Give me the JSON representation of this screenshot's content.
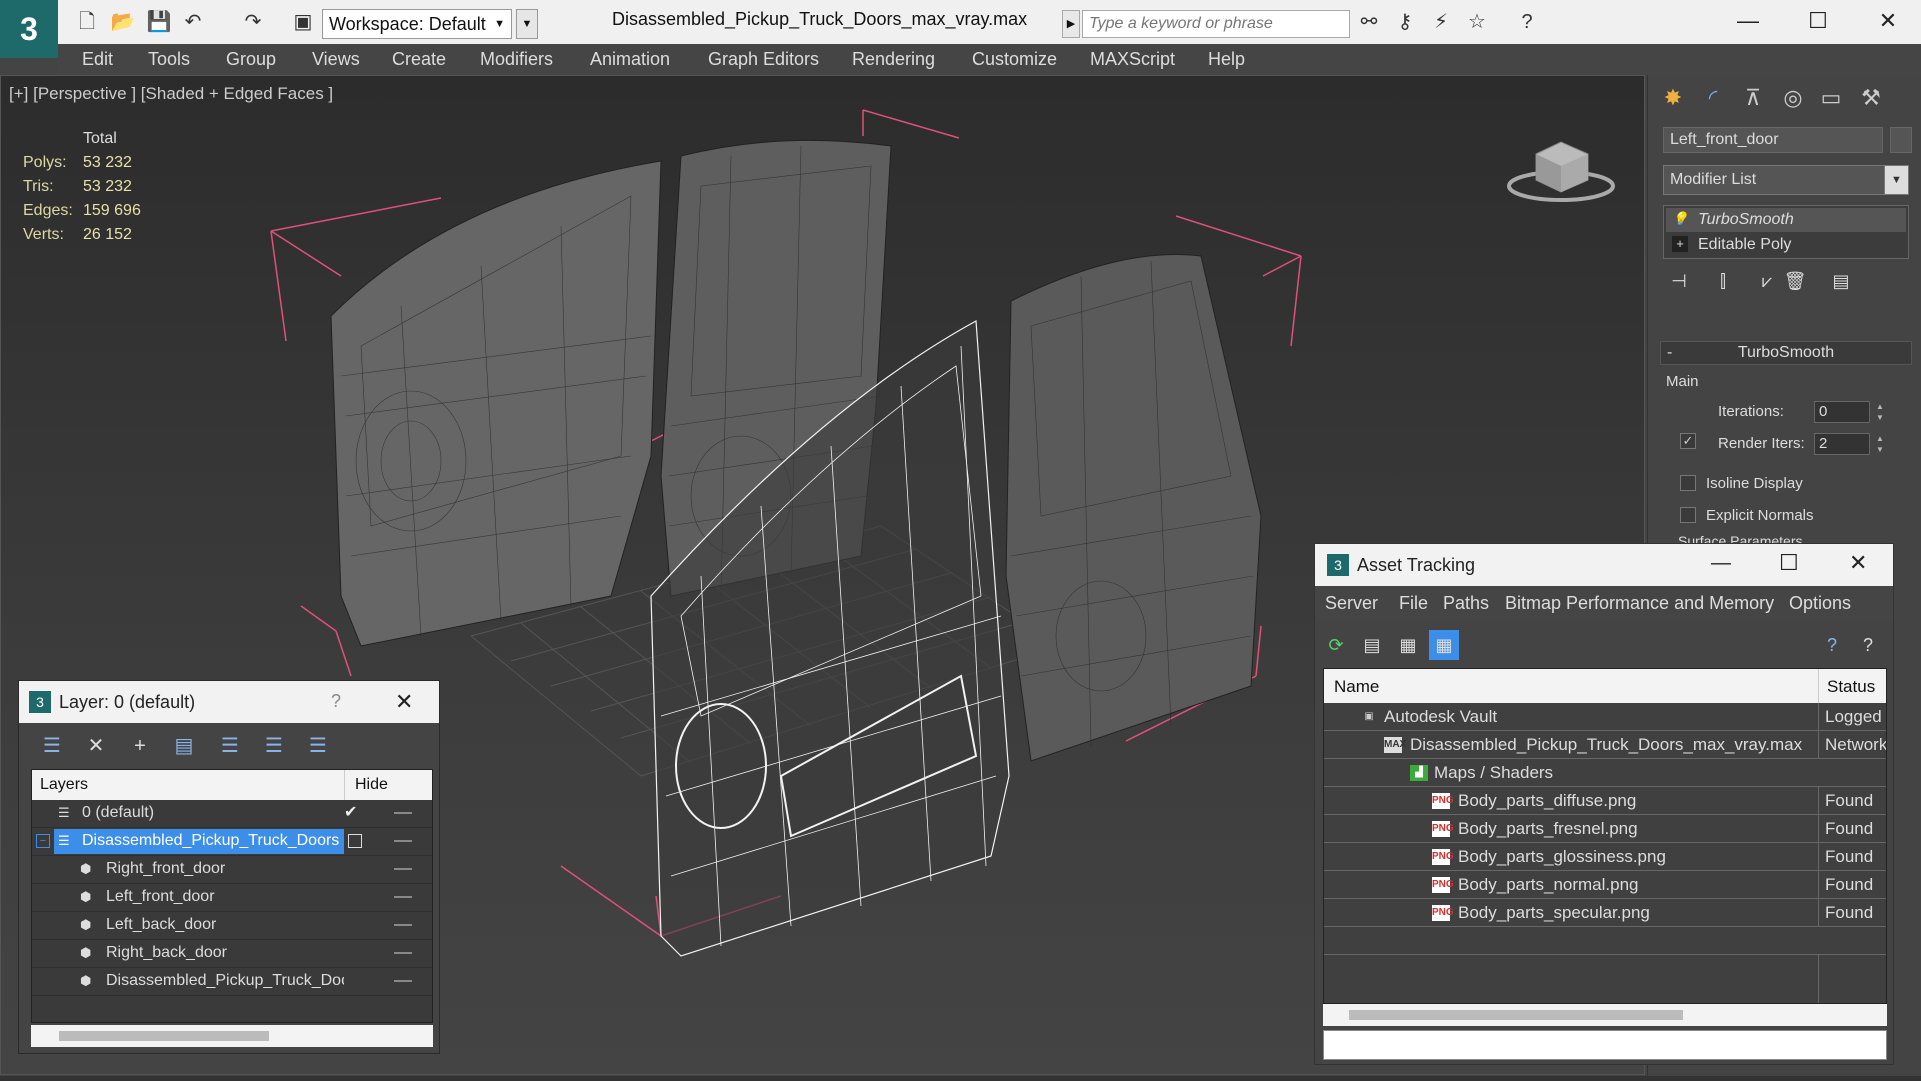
{
  "titlebar": {
    "workspace_label": "Workspace: Default",
    "document_title": "Disassembled_Pickup_Truck_Doors_max_vray.max",
    "search_placeholder": "Type a keyword or phrase",
    "minimize": "—",
    "maximize": "☐",
    "close": "✕"
  },
  "menubar": {
    "items": [
      "Edit",
      "Tools",
      "Group",
      "Views",
      "Create",
      "Modifiers",
      "Animation",
      "Graph Editors",
      "Rendering",
      "Customize",
      "MAXScript",
      "Help"
    ]
  },
  "viewport": {
    "label": "[+] [Perspective ] [Shaded + Edged Faces ]",
    "stats": {
      "header": "Total",
      "rows": [
        {
          "key": "Polys:",
          "value": "53 232"
        },
        {
          "key": "Tris:",
          "value": "53 232"
        },
        {
          "key": "Edges:",
          "value": "159 696"
        },
        {
          "key": "Verts:",
          "value": "26 152"
        }
      ]
    }
  },
  "command_panel": {
    "object_name": "Left_front_door",
    "modifier_list": "Modifier List",
    "stack": [
      {
        "label": "TurboSmooth",
        "icon": "lightbulb-icon"
      },
      {
        "label": "Editable Poly",
        "icon": "plus-box-icon"
      }
    ],
    "rollout_title": "TurboSmooth",
    "main_group": "Main",
    "iterations_label": "Iterations:",
    "iterations_value": "0",
    "render_iters_label": "Render Iters:",
    "render_iters_value": "2",
    "isoline_label": "Isoline Display",
    "explicit_normals_label": "Explicit Normals",
    "surface_params_label": "Surface Parameters"
  },
  "layer_dialog": {
    "title": "Layer: 0 (default)",
    "help": "?",
    "close": "✕",
    "col_layers": "Layers",
    "col_hide": "Hide",
    "rows": [
      {
        "name": "0 (default)",
        "indent": 0,
        "type": "layer",
        "selected": false,
        "current": true
      },
      {
        "name": "Disassembled_Pickup_Truck_Doors",
        "indent": 0,
        "type": "layer",
        "selected": true,
        "current": false
      },
      {
        "name": "Right_front_door",
        "indent": 1,
        "type": "object",
        "selected": false,
        "current": false
      },
      {
        "name": "Left_front_door",
        "indent": 1,
        "type": "object",
        "selected": false,
        "current": false
      },
      {
        "name": "Left_back_door",
        "indent": 1,
        "type": "object",
        "selected": false,
        "current": false
      },
      {
        "name": "Right_back_door",
        "indent": 1,
        "type": "object",
        "selected": false,
        "current": false
      },
      {
        "name": "Disassembled_Pickup_Truck_Doo",
        "indent": 1,
        "type": "object",
        "selected": false,
        "current": false
      }
    ]
  },
  "asset_tracking": {
    "title": "Asset Tracking",
    "minimize": "—",
    "maximize": "☐",
    "close": "✕",
    "menu": [
      "Server",
      "File",
      "Paths",
      "Bitmap Performance and Memory",
      "Options"
    ],
    "col_name": "Name",
    "col_status": "Status",
    "rows": [
      {
        "name": "Autodesk Vault",
        "indent": 1,
        "icon": "vault-icon",
        "status": "Logged O"
      },
      {
        "name": "Disassembled_Pickup_Truck_Doors_max_vray.max",
        "indent": 2,
        "icon": "max-file-icon",
        "status": "Network F"
      },
      {
        "name": "Maps / Shaders",
        "indent": 3,
        "icon": "maps-icon",
        "status": ""
      },
      {
        "name": "Body_parts_diffuse.png",
        "indent": 4,
        "icon": "png-icon",
        "status": "Found"
      },
      {
        "name": "Body_parts_fresnel.png",
        "indent": 4,
        "icon": "png-icon",
        "status": "Found"
      },
      {
        "name": "Body_parts_glossiness.png",
        "indent": 4,
        "icon": "png-icon",
        "status": "Found"
      },
      {
        "name": "Body_parts_normal.png",
        "indent": 4,
        "icon": "png-icon",
        "status": "Found"
      },
      {
        "name": "Body_parts_specular.png",
        "indent": 4,
        "icon": "png-icon",
        "status": "Found"
      }
    ]
  },
  "colors": {
    "accent_selected": "#3d8ee8",
    "stats_text": "#e8e0a8",
    "bbox_pink": "#e0507a"
  }
}
